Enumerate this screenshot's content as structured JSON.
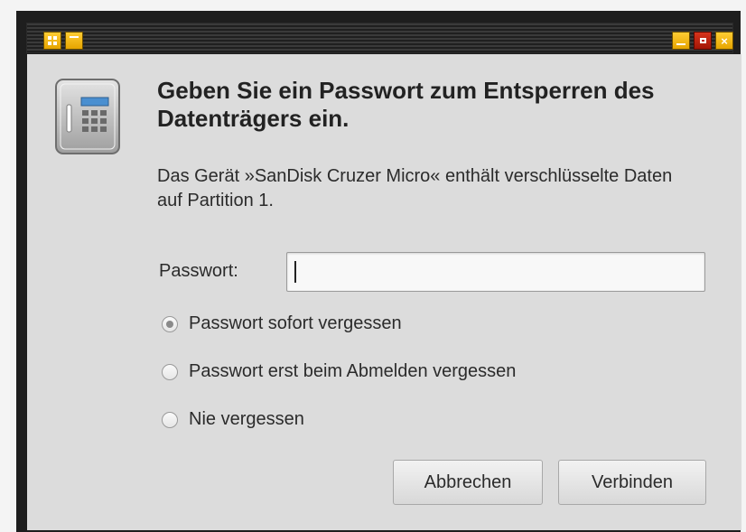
{
  "window": {
    "controls": {
      "menu_icon": "window-menu-icon",
      "shade_icon": "shade-icon",
      "minimize_icon": "minimize-icon",
      "maximize_icon": "maximize-icon",
      "close_icon": "close-icon",
      "close_glyph": "×"
    },
    "accent_color": "#f2b705",
    "danger_color": "#c0240e"
  },
  "dialog": {
    "icon": "safe-vault-icon",
    "heading": "Geben Sie ein Passwort zum Entsperren des Datenträgers ein.",
    "description": "Das Gerät »SanDisk Cruzer Micro« enthält verschlüsselte Daten auf Partition 1.",
    "password_label": "Passwort:",
    "password_value": "",
    "options": [
      {
        "label": "Passwort sofort vergessen",
        "checked": true
      },
      {
        "label": "Passwort erst beim Abmelden vergessen",
        "checked": false
      },
      {
        "label": "Nie vergessen",
        "checked": false
      }
    ],
    "cancel_label": "Abbrechen",
    "connect_label": "Verbinden"
  }
}
